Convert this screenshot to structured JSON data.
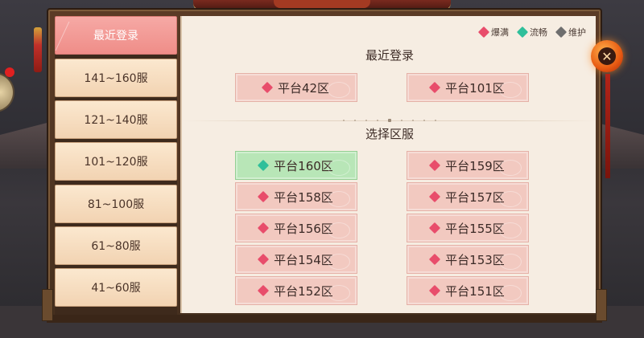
{
  "legend": [
    {
      "label": "爆满",
      "color": "#e84d6b"
    },
    {
      "label": "流畅",
      "color": "#2fbf9a"
    },
    {
      "label": "维护",
      "color": "#6e6e6e"
    }
  ],
  "tabs": [
    {
      "label": "最近登录",
      "active": true
    },
    {
      "label": "141~160服",
      "active": false
    },
    {
      "label": "121~140服",
      "active": false
    },
    {
      "label": "101~120服",
      "active": false
    },
    {
      "label": "81~100服",
      "active": false
    },
    {
      "label": "61~80服",
      "active": false
    },
    {
      "label": "41~60服",
      "active": false
    }
  ],
  "recent": {
    "title": "最近登录",
    "servers": [
      {
        "name": "平台42区",
        "status": "full"
      },
      {
        "name": "平台101区",
        "status": "full"
      }
    ]
  },
  "select": {
    "title": "选择区服",
    "servers": [
      {
        "name": "平台160区",
        "status": "smooth"
      },
      {
        "name": "平台159区",
        "status": "full"
      },
      {
        "name": "平台158区",
        "status": "full"
      },
      {
        "name": "平台157区",
        "status": "full"
      },
      {
        "name": "平台156区",
        "status": "full"
      },
      {
        "name": "平台155区",
        "status": "full"
      },
      {
        "name": "平台154区",
        "status": "full"
      },
      {
        "name": "平台153区",
        "status": "full"
      },
      {
        "name": "平台152区",
        "status": "full"
      },
      {
        "name": "平台151区",
        "status": "full"
      }
    ]
  },
  "status_colors": {
    "full": "#e84d6b",
    "smooth": "#2fbf9a",
    "maintenance": "#6e6e6e"
  },
  "close_icon": "close-icon"
}
